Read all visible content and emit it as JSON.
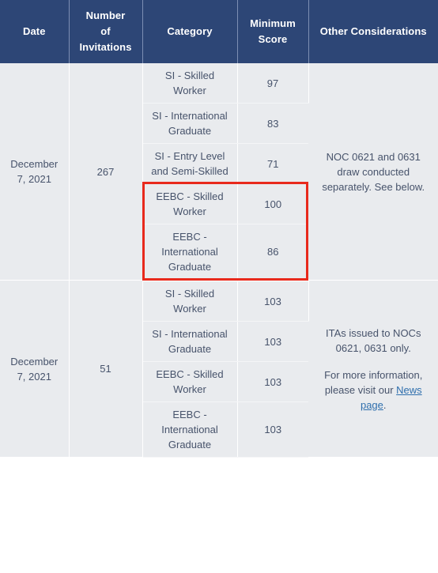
{
  "table": {
    "columns": [
      {
        "key": "date",
        "label": "Date"
      },
      {
        "key": "num",
        "label": "Number of Invitations"
      },
      {
        "key": "cat",
        "label": "Category"
      },
      {
        "key": "score",
        "label": "Minimum Score"
      },
      {
        "key": "other",
        "label": "Other Considerations"
      }
    ],
    "header_labels": {
      "date": "Date",
      "number_line1": "Number",
      "number_line2": "of",
      "number_line3": "Invitations",
      "category": "Category",
      "score_line1": "Minimum",
      "score_line2": "Score",
      "other": "Other Considerations"
    },
    "groups": [
      {
        "date": "December 7, 2021",
        "date_line1": "December",
        "date_line2": "7, 2021",
        "invitations": "267",
        "other_considerations": "NOC 0621 and 0631 draw conducted separately. See below.",
        "other_paragraphs": [
          {
            "text": "NOC 0621 and 0631 draw conducted separately. See below."
          }
        ],
        "rows": [
          {
            "category": "SI - Skilled Worker",
            "score": "97",
            "highlighted": false
          },
          {
            "category": "SI - International Graduate",
            "score": "83",
            "highlighted": false
          },
          {
            "category": "SI - Entry Level and Semi-Skilled",
            "score": "71",
            "highlighted": false
          },
          {
            "category": "EEBC - Skilled Worker",
            "score": "100",
            "highlighted": true
          },
          {
            "category": "EEBC - International Graduate",
            "score": "86",
            "highlighted": true
          }
        ]
      },
      {
        "date": "December 7, 2021",
        "date_line1": "December",
        "date_line2": "7, 2021",
        "invitations": "51",
        "other_considerations": "ITAs issued to NOCs 0621, 0631 only. For more information, please visit our News page.",
        "other_paragraphs": [
          {
            "text": "ITAs issued to NOCs 0621, 0631 only."
          },
          {
            "text_before": "For more information, please visit our ",
            "link_text": "News page",
            "text_after": "."
          }
        ],
        "rows": [
          {
            "category": "SI - Skilled Worker",
            "score": "103",
            "highlighted": false
          },
          {
            "category": "SI - International Graduate",
            "score": "103",
            "highlighted": false
          },
          {
            "category": "EEBC - Skilled Worker",
            "score": "103",
            "highlighted": false
          },
          {
            "category": "EEBC - International Graduate",
            "score": "103",
            "highlighted": false
          }
        ]
      }
    ]
  },
  "annotation": {
    "highlight_color": "#e8291c",
    "highlight_label": "red-rectangle-highlight-eebc-rows"
  },
  "theme": {
    "header_bg": "#2d4676",
    "header_text": "#ffffff",
    "cell_bg": "#e9ebee",
    "cell_text": "#47536b",
    "grid_line": "#ffffff",
    "link_color": "#2f6fad"
  }
}
